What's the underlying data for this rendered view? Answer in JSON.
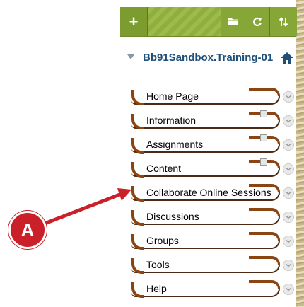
{
  "toolbar": {
    "add_label": "+",
    "add_icon": "plus-icon",
    "folder_icon": "folder-icon",
    "refresh_icon": "refresh-icon",
    "sort_icon": "sort-icon"
  },
  "course": {
    "title": "Bb91Sandbox.Training-01",
    "collapse_icon": "triangle-down-icon",
    "home_icon": "home-icon"
  },
  "menu": {
    "items": [
      {
        "label": "Home Page",
        "has_doc_icon": false
      },
      {
        "label": "Information",
        "has_doc_icon": true
      },
      {
        "label": "Assignments",
        "has_doc_icon": true
      },
      {
        "label": "Content",
        "has_doc_icon": true
      },
      {
        "label": "Collaborate Online Sessions",
        "has_doc_icon": false
      },
      {
        "label": "Discussions",
        "has_doc_icon": false
      },
      {
        "label": "Groups",
        "has_doc_icon": false
      },
      {
        "label": "Tools",
        "has_doc_icon": false
      },
      {
        "label": "Help",
        "has_doc_icon": false
      }
    ]
  },
  "annotation": {
    "callout_label": "A",
    "color": "#c9202a"
  },
  "colors": {
    "toolbar_green": "#8fae3e",
    "title_blue": "#1f4e79",
    "swoosh_brown": "#8b4513"
  }
}
